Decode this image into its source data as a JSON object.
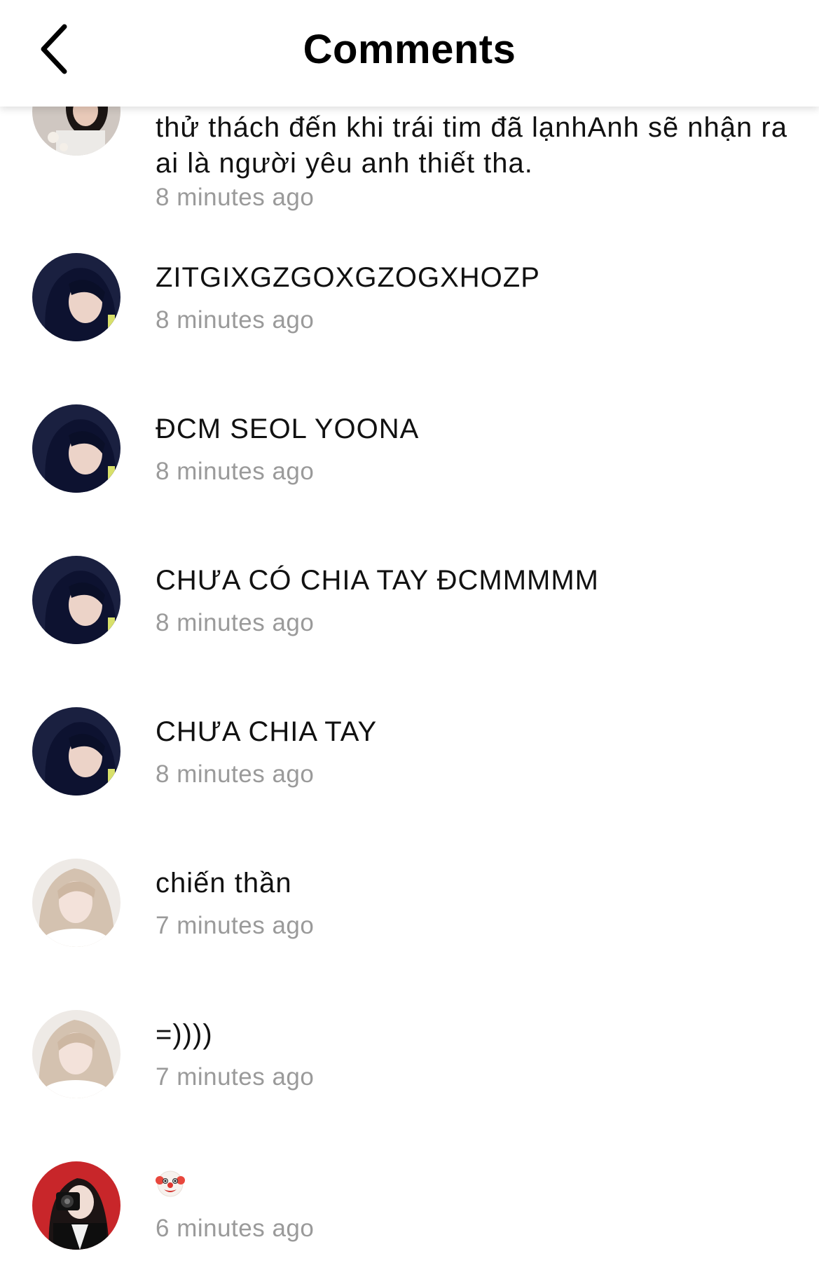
{
  "header": {
    "title": "Comments",
    "back_icon": "chevron-left-icon"
  },
  "comments": [
    {
      "text": "thử thách đến khi trái tim đã lạnhAnh sẽ nhận ra ai là người yêu anh thiết tha.",
      "time": "8 minutes ago",
      "avatar": "girl-avatar-flower"
    },
    {
      "text": "ZITGIXGZGOXGZOGXHOZP",
      "time": "8 minutes ago",
      "avatar": "girl-avatar-dark-hair"
    },
    {
      "text": "ĐCM SEOL YOONA",
      "time": "8 minutes ago",
      "avatar": "girl-avatar-dark-hair"
    },
    {
      "text": "CHƯA CÓ CHIA TAY ĐCMMMMM",
      "time": "8 minutes ago",
      "avatar": "girl-avatar-dark-hair"
    },
    {
      "text": "CHƯA CHIA TAY",
      "time": "8 minutes ago",
      "avatar": "girl-avatar-dark-hair"
    },
    {
      "text": "chiến thần",
      "time": "7 minutes ago",
      "avatar": "girl-avatar-blonde"
    },
    {
      "text": "=))))",
      "time": "7 minutes ago",
      "avatar": "girl-avatar-blonde"
    },
    {
      "text": "",
      "emoji": "clown-face-icon",
      "time": "6 minutes ago",
      "avatar": "girl-avatar-camera-red"
    }
  ]
}
